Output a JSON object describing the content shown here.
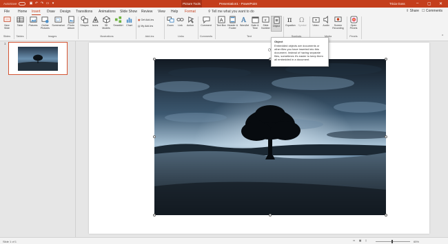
{
  "titlebar": {
    "autosave": "AutoSave",
    "toggle_state": "Off",
    "context_tab": "Picture Tools",
    "doc_title": "Presentation1 - PowerPoint",
    "user": "Tricia Goss"
  },
  "tabs": [
    "File",
    "Home",
    "Insert",
    "Draw",
    "Design",
    "Transitions",
    "Animations",
    "Slide Show",
    "Review",
    "View",
    "Help"
  ],
  "active_tab": "Insert",
  "context_tab": "Format",
  "tell_me": "Tell me what you want to do",
  "share": "Share",
  "comments_top": "Comments",
  "ribbon": {
    "slides": {
      "new_slide": "New Slide",
      "group": "Slides"
    },
    "tables": {
      "table": "Table",
      "group": "Tables"
    },
    "images": {
      "pictures": "Pictures",
      "online_pictures": "Online Pictures",
      "screenshot": "Screenshot",
      "photo_album": "Photo Album",
      "group": "Images"
    },
    "illustrations": {
      "shapes": "Shapes",
      "icons": "Icons",
      "models": "3D Models",
      "smartart": "SmartArt",
      "chart": "Chart",
      "group": "Illustrations"
    },
    "addins": {
      "get_addins": "Get Add-ins",
      "my_addins": "My Add-ins",
      "group": "Add-ins"
    },
    "links": {
      "zoom": "Zoom",
      "link": "Link",
      "action": "Action",
      "group": "Links"
    },
    "comments": {
      "comment": "Comment",
      "group": "Comments"
    },
    "text": {
      "text_box": "Text Box",
      "header_footer": "Header & Footer",
      "wordart": "WordArt",
      "date_time": "Date & Time",
      "slide_number": "Slide Number",
      "object": "Object",
      "group": "Text"
    },
    "symbols": {
      "equation": "Equation",
      "symbol": "Symbol",
      "group": "Symbols"
    },
    "media": {
      "video": "Video",
      "audio": "Audio",
      "screen_recording": "Screen Recording",
      "group": "Media"
    },
    "pexels": {
      "open_pexels": "Open Pexels",
      "group": "Pexels"
    }
  },
  "tooltip": {
    "title": "Object",
    "body": "Embedded objects are documents or other files you have inserted into this document. Instead of having separate files, sometimes it's easier to keep them all embedded in a document."
  },
  "thumbnails": [
    {
      "number": "1"
    }
  ],
  "statusbar": {
    "slide_info": "Slide 1 of 1",
    "zoom": "65%"
  },
  "colors": {
    "accent": "#c43e1c",
    "ribbon_bg": "#f3f3f3",
    "workspace": "#e6e6e6"
  }
}
